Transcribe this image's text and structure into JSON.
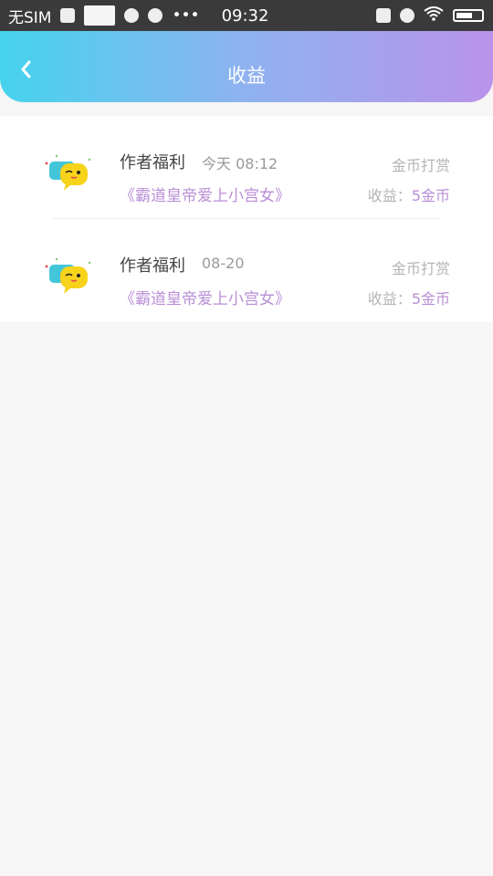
{
  "status_bar": {
    "carrier": "无SIM",
    "time": "09:32"
  },
  "header": {
    "title": "收益"
  },
  "records": [
    {
      "author_label": "作者福利",
      "time": "今天 08:12",
      "book": "《霸道皇帝爱上小宫女》",
      "type": "金币打赏",
      "income_prefix": "收益：",
      "income_value": "5金币"
    },
    {
      "author_label": "作者福利",
      "time": "08-20",
      "book": "《霸道皇帝爱上小宫女》",
      "type": "金币打赏",
      "income_prefix": "收益：",
      "income_value": "5金币"
    }
  ],
  "icons": {
    "back": "chevron-left-icon",
    "avatar": "speech-bubble-emoji-icon"
  },
  "colors": {
    "header_gradient_start": "#45d3ee",
    "header_gradient_end": "#b993ea",
    "accent_purple": "#b98ed6"
  }
}
